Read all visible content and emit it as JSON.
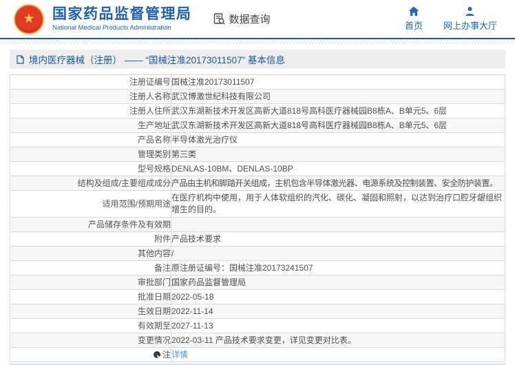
{
  "header": {
    "emblem_icon": "national-emblem-icon",
    "title_cn": "国家药品监督管理局",
    "title_en": "National Medical Products Administration",
    "data_query": {
      "label": "数据查询",
      "icon": "doc-search-icon"
    },
    "nav": [
      {
        "label": "首页",
        "icon": "home-icon"
      },
      {
        "label": "网上办事大厅",
        "icon": "person-icon"
      }
    ]
  },
  "breadcrumb": {
    "icon": "document-icon",
    "text": "境内医疗器械（注册） —— “国械注准20173011507” 基本信息"
  },
  "table": {
    "rows": [
      {
        "label": "注册证编号",
        "value": "国械注准20173011507"
      },
      {
        "label": "注册人名称",
        "value": "武汉博激世纪科技有限公司"
      },
      {
        "label": "注册人住所",
        "value": "武汉东湖新技术开发区高新大道818号高科医疗器械园B8栋A、B单元5、6层"
      },
      {
        "label": "生产地址",
        "value": "武汉东湖新技术开发区高新大道818号高科医疗器械园B8栋A、B单元5、6层"
      },
      {
        "label": "产品名称",
        "value": "半导体激光治疗仪"
      },
      {
        "label": "管理类别",
        "value": "第三类"
      },
      {
        "label": "型号规格",
        "value": "DENLAS-10BM、DENLAS-10BP"
      },
      {
        "label": "结构及组成/主要组成成分",
        "value": "产品由主机和脚踏开关组成，主机包含半导体激光器、电源系统及控制装置、安全防护装置。"
      },
      {
        "label": "适用范围/预期用途",
        "value": "在医疗机构中使用，用于人体软组织的汽化、碳化、凝固和照射，以达到治疗口腔牙龈组织增生的目的。",
        "wrap": true
      },
      {
        "label": "产品储存条件及有效期",
        "value": ""
      },
      {
        "label": "附件",
        "value": "产品技术要求"
      },
      {
        "label": "其他内容",
        "value": "/"
      },
      {
        "label": "备注",
        "value": "原注册证编号：国械注准20173241507"
      },
      {
        "label": "审批部门",
        "value": "国家药品监督管理局"
      },
      {
        "label": "批准日期",
        "value": "2022-05-18"
      },
      {
        "label": "生效日期",
        "value": "2022-11-14"
      },
      {
        "label": "有效期至",
        "value": "2027-11-13"
      },
      {
        "label": "变更情况",
        "value": "2022-03-11 产品技术要求变更，详见变更对比表。"
      },
      {
        "label": "注",
        "value": "详情",
        "link": true,
        "note_icon": "note-dot-icon"
      }
    ]
  },
  "colors": {
    "accent_blue": "#1c61ae",
    "nav_blue": "#1d64b0",
    "link_blue": "#4a97dc",
    "header_border_blue": "#28588f",
    "breadcrumb_bg": "#ededed",
    "row_alt_bg": "#f7f7f7",
    "emblem_red": "#d0281c",
    "emblem_gold": "#e9b53c"
  }
}
